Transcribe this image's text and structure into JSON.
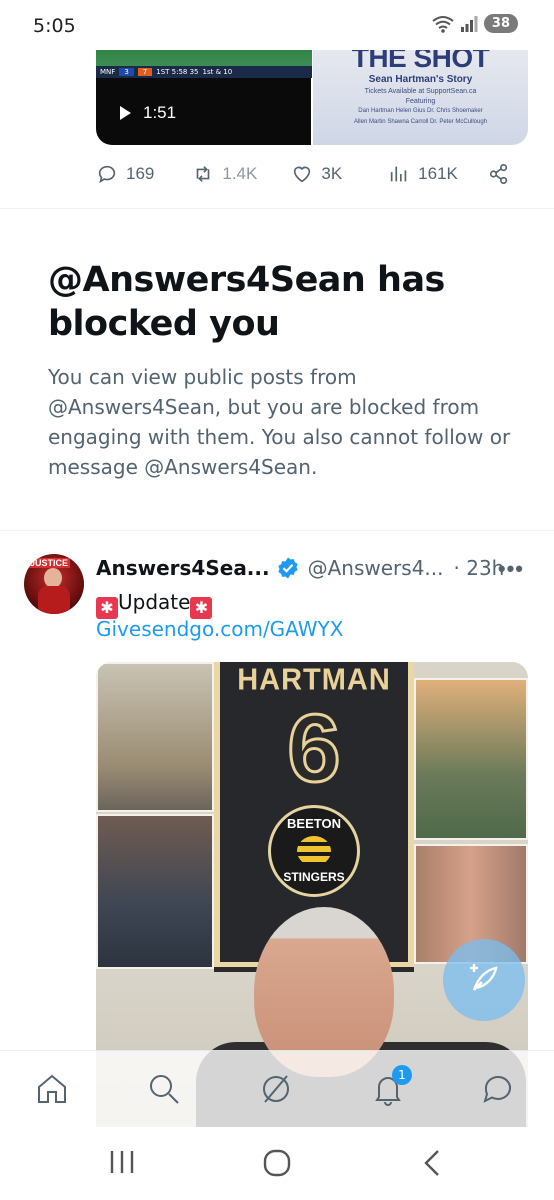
{
  "status_bar": {
    "time": "5:05",
    "battery": "38"
  },
  "prev_tweet": {
    "video": {
      "duration": "1:51",
      "score_home": "3",
      "score_away": "7",
      "clock": "1ST 5:58 35",
      "down": "1st & 10",
      "network": "MNF"
    },
    "poster": {
      "title": "THE SHOT",
      "subtitle": "Sean Hartman's Story",
      "tickets": "Tickets Available at SupportSean.ca",
      "featuring": "Featuring",
      "names_line1": "Dan Hartman     Helen Gius     Dr. Chris Shoemaker",
      "names_line2": "Allen Martin     Shawna Carroll     Dr. Peter McCullough"
    },
    "engagement": {
      "replies": "169",
      "reposts": "1.4K",
      "likes": "3K",
      "views": "161K"
    }
  },
  "block_notice": {
    "title": "@Answers4Sean has blocked you",
    "body": "You can view public posts from @Answers4Sean, but you are blocked from engaging with them. You also cannot follow or message @Answers4Sean."
  },
  "tweet": {
    "display_name": "Answers4Sea...",
    "handle": "@Answers4...",
    "time": "· 23h",
    "more": "•••",
    "text": "Update",
    "siren": "🚨",
    "link": "Givesendgo.com/GAWYX",
    "avatar_tag": "JUSTICE",
    "image": {
      "jersey_name": "HARTMAN",
      "jersey_number": "6",
      "crest_top": "BEETON",
      "crest_bottom": "STINGERS"
    }
  },
  "tabbar": {
    "notifications_badge": "1"
  },
  "colors": {
    "accent": "#1d9bf0",
    "text": "#0f1419",
    "muted": "#536471"
  }
}
